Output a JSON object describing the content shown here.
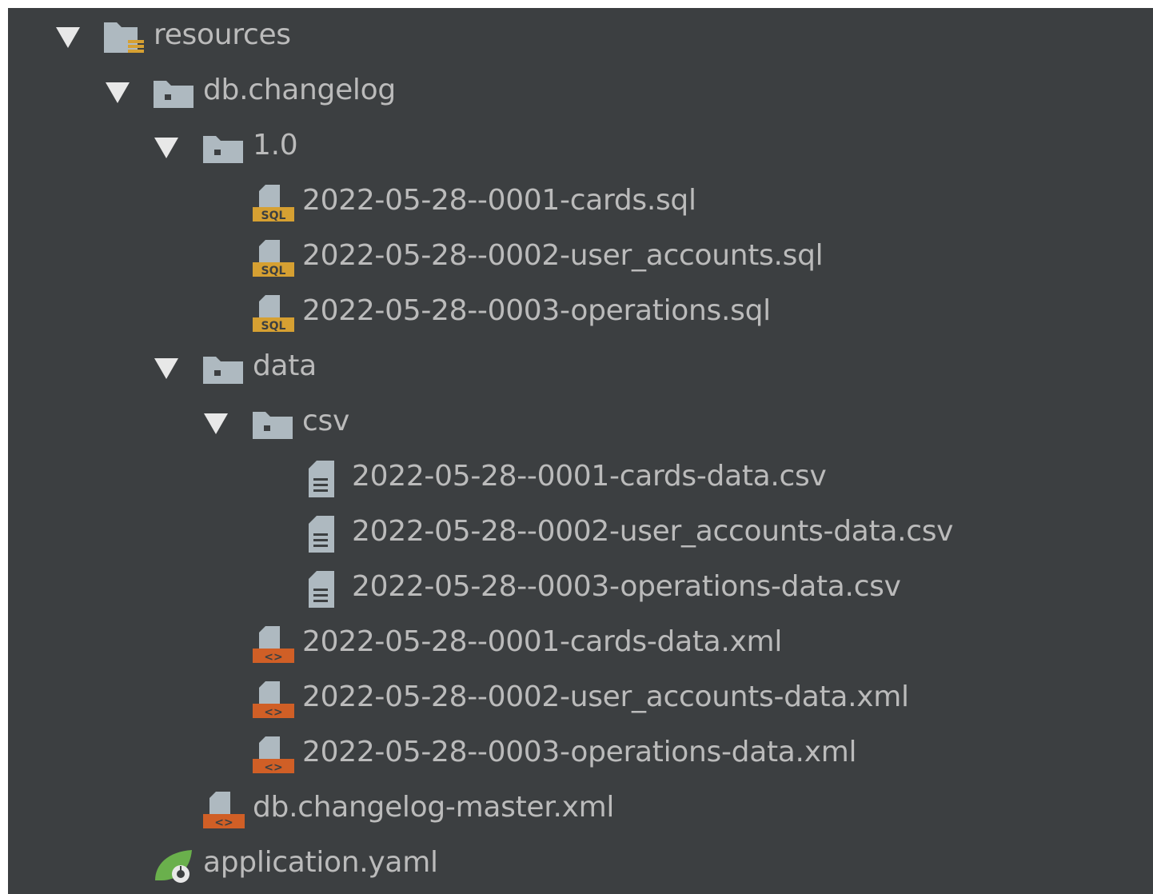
{
  "tree": {
    "items": [
      {
        "label": "resources",
        "icon": "resources-folder-icon",
        "depth": 0,
        "expanded": true
      },
      {
        "label": "db.changelog",
        "icon": "folder-icon",
        "depth": 1,
        "expanded": true
      },
      {
        "label": "1.0",
        "icon": "folder-icon",
        "depth": 2,
        "expanded": true
      },
      {
        "label": "2022-05-28--0001-cards.sql",
        "icon": "sql-file-icon",
        "depth": 3
      },
      {
        "label": "2022-05-28--0002-user_accounts.sql",
        "icon": "sql-file-icon",
        "depth": 3
      },
      {
        "label": "2022-05-28--0003-operations.sql",
        "icon": "sql-file-icon",
        "depth": 3
      },
      {
        "label": "data",
        "icon": "folder-icon",
        "depth": 2,
        "expanded": true
      },
      {
        "label": "csv",
        "icon": "folder-icon",
        "depth": 3,
        "expanded": true
      },
      {
        "label": "2022-05-28--0001-cards-data.csv",
        "icon": "text-file-icon",
        "depth": 4
      },
      {
        "label": "2022-05-28--0002-user_accounts-data.csv",
        "icon": "text-file-icon",
        "depth": 4
      },
      {
        "label": "2022-05-28--0003-operations-data.csv",
        "icon": "text-file-icon",
        "depth": 4
      },
      {
        "label": "2022-05-28--0001-cards-data.xml",
        "icon": "xml-file-icon",
        "depth": 3
      },
      {
        "label": "2022-05-28--0002-user_accounts-data.xml",
        "icon": "xml-file-icon",
        "depth": 3
      },
      {
        "label": "2022-05-28--0003-operations-data.xml",
        "icon": "xml-file-icon",
        "depth": 3
      },
      {
        "label": "db.changelog-master.xml",
        "icon": "xml-file-icon",
        "depth": 2
      },
      {
        "label": "application.yaml",
        "icon": "spring-config-icon",
        "depth": 1
      }
    ]
  },
  "colors": {
    "background": "#3c3f41",
    "text": "#bbbbbb",
    "arrow": "#e8e8e8",
    "folder": "#aeb9c0",
    "sql_badge": "#d6a032",
    "xml_badge": "#d05f26",
    "spring_leaf": "#6ab04c"
  }
}
